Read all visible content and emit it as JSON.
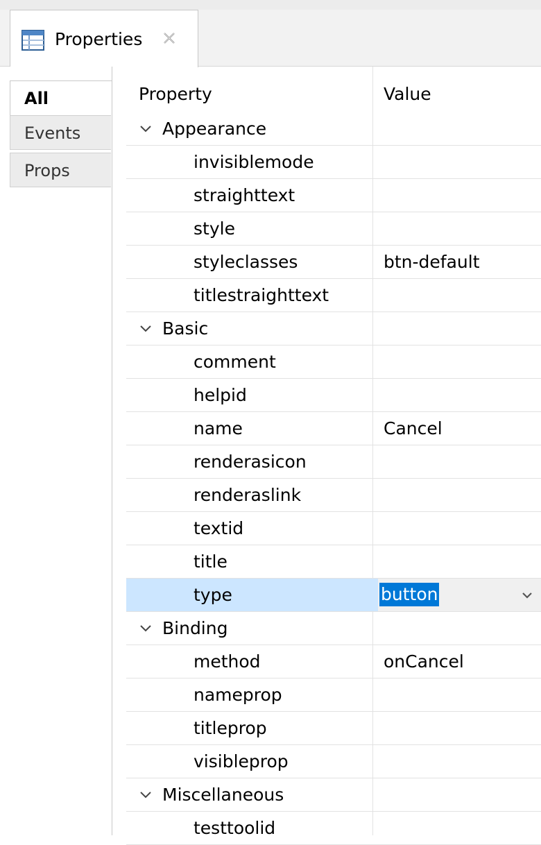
{
  "view": {
    "title": "Properties",
    "icon": "properties-table-icon",
    "close_icon": "close-icon"
  },
  "side_tabs": [
    {
      "label": "All",
      "active": true
    },
    {
      "label": "Events",
      "active": false
    },
    {
      "label": "Props",
      "active": false
    }
  ],
  "table": {
    "header_property": "Property",
    "header_value": "Value",
    "categories": {
      "appearance": "Appearance",
      "basic": "Basic",
      "binding": "Binding",
      "misc": "Miscellaneous"
    },
    "rows": {
      "invisiblemode": {
        "name": "invisiblemode",
        "value": ""
      },
      "straighttext": {
        "name": "straighttext",
        "value": ""
      },
      "style": {
        "name": "style",
        "value": ""
      },
      "styleclasses": {
        "name": "styleclasses",
        "value": "btn-default"
      },
      "titlestraighttext": {
        "name": "titlestraighttext",
        "value": ""
      },
      "comment": {
        "name": "comment",
        "value": ""
      },
      "helpid": {
        "name": "helpid",
        "value": ""
      },
      "name": {
        "name": "name",
        "value": "Cancel"
      },
      "renderasicon": {
        "name": "renderasicon",
        "value": ""
      },
      "renderaslink": {
        "name": "renderaslink",
        "value": ""
      },
      "textid": {
        "name": "textid",
        "value": ""
      },
      "title": {
        "name": "title",
        "value": ""
      },
      "type": {
        "name": "type",
        "value": "button"
      },
      "method": {
        "name": "method",
        "value": "onCancel"
      },
      "nameprop": {
        "name": "nameprop",
        "value": ""
      },
      "titleprop": {
        "name": "titleprop",
        "value": ""
      },
      "visibleprop": {
        "name": "visibleprop",
        "value": ""
      },
      "testtoolid": {
        "name": "testtoolid",
        "value": ""
      }
    },
    "selected_row": "type"
  },
  "colors": {
    "selection_row": "#cce6ff",
    "selection_text_bg": "#0078d7",
    "accent_icon": "#1f6fbf"
  }
}
